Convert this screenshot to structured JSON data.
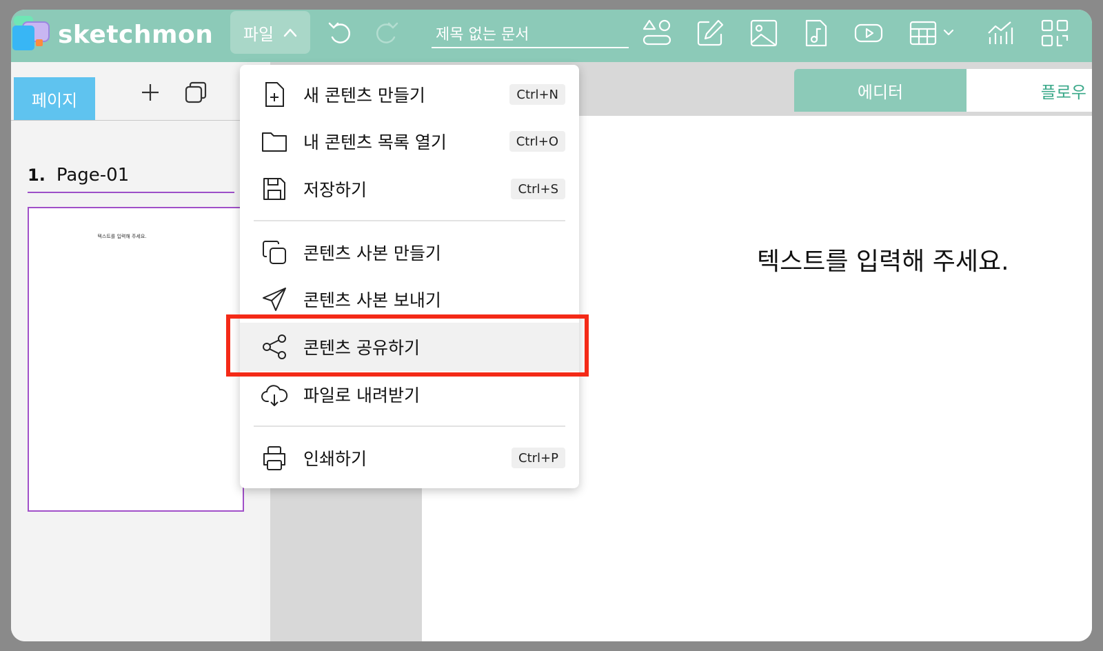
{
  "app": {
    "name": "sketchmon"
  },
  "toolbar": {
    "file_menu_label": "파일",
    "document_title": "제목 없는 문서",
    "icons": [
      "undo-icon",
      "redo-icon",
      "shapes-icon",
      "pen-icon",
      "image-icon",
      "audio-icon",
      "video-icon",
      "table-icon",
      "chart-icon",
      "qr-code-icon"
    ]
  },
  "left_panel": {
    "pages_tab_label": "페이지",
    "page_number": "1.",
    "page_name": "Page-01",
    "thumbnail_text": "텍스트를 입력해 주세요."
  },
  "mode_tabs": {
    "editor": "에디터",
    "flow": "플로우"
  },
  "canvas": {
    "text": "텍스트를 입력해 주세요."
  },
  "file_menu": {
    "items": [
      {
        "label": "새 콘텐츠 만들기",
        "shortcut": "Ctrl+N",
        "icon": "new-file-icon"
      },
      {
        "label": "내 콘텐츠 목록 열기",
        "shortcut": "Ctrl+O",
        "icon": "folder-icon"
      },
      {
        "label": "저장하기",
        "shortcut": "Ctrl+S",
        "icon": "save-icon"
      },
      {
        "label": "콘텐츠 사본 만들기",
        "shortcut": "",
        "icon": "copy-icon"
      },
      {
        "label": "콘텐츠 사본 보내기",
        "shortcut": "",
        "icon": "send-icon"
      },
      {
        "label": "콘텐츠 공유하기",
        "shortcut": "",
        "icon": "share-icon"
      },
      {
        "label": "파일로 내려받기",
        "shortcut": "",
        "icon": "cloud-download-icon"
      },
      {
        "label": "인쇄하기",
        "shortcut": "Ctrl+P",
        "icon": "print-icon"
      }
    ],
    "highlighted_item": "콘텐츠 공유하기"
  },
  "colors": {
    "topbar": "#8ccab8",
    "accent_blue": "#5fc3ef",
    "highlight_red": "#f42a17",
    "page_border": "#a04fc8"
  }
}
